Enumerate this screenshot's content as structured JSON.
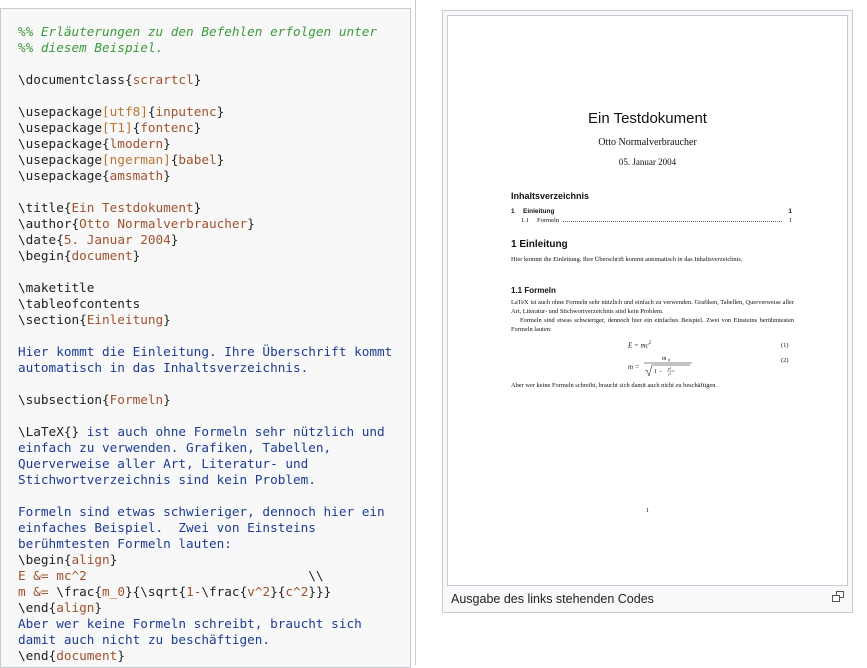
{
  "code": {
    "lines": [
      [
        [
          "cm",
          "%% Erläuterungen zu den Befehlen erfolgen unter"
        ]
      ],
      [
        [
          "cm",
          "%% diesem Beispiel."
        ]
      ],
      [],
      [
        [
          "cmd",
          "\\documentclass"
        ],
        [
          "cmd",
          "{"
        ],
        [
          "arg",
          "scrartcl"
        ],
        [
          "cmd",
          "}"
        ]
      ],
      [],
      [
        [
          "cmd",
          "\\usepackage"
        ],
        [
          "opt",
          "[utf8]"
        ],
        [
          "cmd",
          "{"
        ],
        [
          "arg",
          "inputenc"
        ],
        [
          "cmd",
          "}"
        ]
      ],
      [
        [
          "cmd",
          "\\usepackage"
        ],
        [
          "opt",
          "[T1]"
        ],
        [
          "cmd",
          "{"
        ],
        [
          "arg",
          "fontenc"
        ],
        [
          "cmd",
          "}"
        ]
      ],
      [
        [
          "cmd",
          "\\usepackage"
        ],
        [
          "cmd",
          "{"
        ],
        [
          "arg",
          "lmodern"
        ],
        [
          "cmd",
          "}"
        ]
      ],
      [
        [
          "cmd",
          "\\usepackage"
        ],
        [
          "opt",
          "[ngerman]"
        ],
        [
          "cmd",
          "{"
        ],
        [
          "arg",
          "babel"
        ],
        [
          "cmd",
          "}"
        ]
      ],
      [
        [
          "cmd",
          "\\usepackage"
        ],
        [
          "cmd",
          "{"
        ],
        [
          "arg",
          "amsmath"
        ],
        [
          "cmd",
          "}"
        ]
      ],
      [],
      [
        [
          "cmd",
          "\\title"
        ],
        [
          "cmd",
          "{"
        ],
        [
          "arg",
          "Ein Testdokument"
        ],
        [
          "cmd",
          "}"
        ]
      ],
      [
        [
          "cmd",
          "\\author"
        ],
        [
          "cmd",
          "{"
        ],
        [
          "arg",
          "Otto Normalverbraucher"
        ],
        [
          "cmd",
          "}"
        ]
      ],
      [
        [
          "cmd",
          "\\date"
        ],
        [
          "cmd",
          "{"
        ],
        [
          "arg",
          "5. Januar 2004"
        ],
        [
          "cmd",
          "}"
        ]
      ],
      [
        [
          "cmd",
          "\\begin"
        ],
        [
          "cmd",
          "{"
        ],
        [
          "arg",
          "document"
        ],
        [
          "cmd",
          "}"
        ]
      ],
      [],
      [
        [
          "cmd",
          "\\maketitle"
        ]
      ],
      [
        [
          "cmd",
          "\\tableofcontents"
        ]
      ],
      [
        [
          "cmd",
          "\\section"
        ],
        [
          "cmd",
          "{"
        ],
        [
          "arg",
          "Einleitung"
        ],
        [
          "cmd",
          "}"
        ]
      ],
      [],
      [
        [
          "txt",
          "Hier kommt die Einleitung. Ihre Überschrift kommt"
        ]
      ],
      [
        [
          "txt",
          "automatisch in das Inhaltsverzeichnis."
        ]
      ],
      [],
      [
        [
          "cmd",
          "\\subsection"
        ],
        [
          "cmd",
          "{"
        ],
        [
          "arg",
          "Formeln"
        ],
        [
          "cmd",
          "}"
        ]
      ],
      [],
      [
        [
          "cmd",
          "\\LaTeX"
        ],
        [
          "cmd",
          "{}"
        ],
        [
          "txt",
          " ist auch ohne Formeln sehr nützlich und"
        ]
      ],
      [
        [
          "txt",
          "einfach zu verwenden. Grafiken, Tabellen,"
        ]
      ],
      [
        [
          "txt",
          "Querverweise aller Art, Literatur- und"
        ]
      ],
      [
        [
          "txt",
          "Stichwortverzeichnis sind kein Problem."
        ]
      ],
      [],
      [
        [
          "txt",
          "Formeln sind etwas schwieriger, dennoch hier ein"
        ]
      ],
      [
        [
          "txt",
          "einfaches Beispiel.  Zwei von Einsteins"
        ]
      ],
      [
        [
          "txt",
          "berühmtesten Formeln lauten:"
        ]
      ],
      [
        [
          "cmd",
          "\\begin"
        ],
        [
          "cmd",
          "{"
        ],
        [
          "arg",
          "align"
        ],
        [
          "cmd",
          "}"
        ]
      ],
      [
        [
          "arg",
          "E &= mc^2                             "
        ],
        [
          "cmd",
          "\\\\"
        ]
      ],
      [
        [
          "arg",
          "m &= "
        ],
        [
          "cmd",
          "\\frac"
        ],
        [
          "cmd",
          "{"
        ],
        [
          "arg",
          "m_0"
        ],
        [
          "cmd",
          "}{"
        ],
        [
          "cmd",
          "\\sqrt"
        ],
        [
          "cmd",
          "{"
        ],
        [
          "arg",
          "1-"
        ],
        [
          "cmd",
          "\\frac"
        ],
        [
          "cmd",
          "{"
        ],
        [
          "arg",
          "v^2"
        ],
        [
          "cmd",
          "}{"
        ],
        [
          "arg",
          "c^2"
        ],
        [
          "cmd",
          "}}}"
        ]
      ],
      [
        [
          "cmd",
          "\\end"
        ],
        [
          "cmd",
          "{"
        ],
        [
          "arg",
          "align"
        ],
        [
          "cmd",
          "}"
        ]
      ],
      [
        [
          "txt",
          "Aber wer keine Formeln schreibt, braucht sich"
        ]
      ],
      [
        [
          "txt",
          "damit auch nicht zu beschäftigen."
        ]
      ],
      [
        [
          "cmd",
          "\\end"
        ],
        [
          "cmd",
          "{"
        ],
        [
          "arg",
          "document"
        ],
        [
          "cmd",
          "}"
        ]
      ]
    ]
  },
  "preview": {
    "title": "Ein Testdokument",
    "author": "Otto Normalverbraucher",
    "date": "05. Januar 2004",
    "toc_heading": "Inhaltsverzeichnis",
    "toc": [
      {
        "num": "1",
        "label": "Einleitung",
        "page": "1",
        "level": 1
      },
      {
        "num": "1.1",
        "label": "Formeln",
        "page": "1",
        "level": 2
      }
    ],
    "section": "1  Einleitung",
    "section_text": "Hier kommt die Einleitung. Ihre Überschrift kommt automatisch in das Inhaltsverzeichnis.",
    "subsection": "1.1  Formeln",
    "para1": "LaTeX ist auch ohne Formeln sehr nützlich und einfach zu verwenden. Grafiken, Tabellen, Querverweise aller Art, Literatur- und Stichwortverzeichnis sind kein Problem.",
    "para2": "Formeln sind etwas schwieriger, dennoch hier ein einfaches Beispiel. Zwei von Einsteins berühmtesten Formeln lauten:",
    "eq1_lhs": "E = mc",
    "eq1_num": "(1)",
    "eq2_lhs": "m =",
    "eq2_num": "(2)",
    "para3": "Aber wer keine Formeln schreibt, braucht sich damit auch nicht zu beschäftigen.",
    "page_number": "1"
  },
  "caption": "Ausgabe des links stehenden Codes",
  "icons": {
    "enlarge": "magnify-icon"
  },
  "colors": {
    "comment": "#3c9a3c",
    "argument": "#a0522d",
    "text": "#1c3c96",
    "option": "#b8762c",
    "border": "#c8ccd1"
  }
}
